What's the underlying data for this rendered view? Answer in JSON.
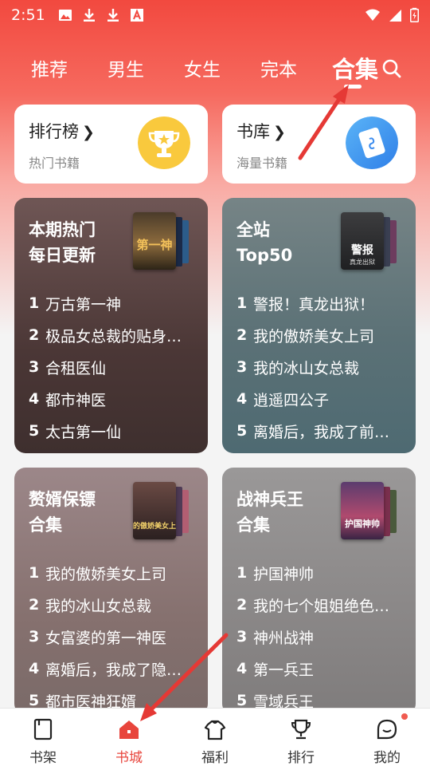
{
  "status_bar": {
    "time": "2:51",
    "left_icons": [
      "image-icon",
      "download-icon",
      "download-icon",
      "font-icon"
    ],
    "right_icons": [
      "wifi-icon",
      "signal-icon",
      "battery-icon"
    ]
  },
  "tabs": [
    {
      "label": "推荐",
      "active": false
    },
    {
      "label": "男生",
      "active": false
    },
    {
      "label": "女生",
      "active": false
    },
    {
      "label": "完本",
      "active": false
    },
    {
      "label": "合集",
      "active": true
    }
  ],
  "top_cards": [
    {
      "title": "排行榜",
      "chevron": "›",
      "subtitle": "热门书籍",
      "icon": "trophy-icon"
    },
    {
      "title": "书库",
      "chevron": "›",
      "subtitle": "海量书籍",
      "icon": "book-icon"
    }
  ],
  "collections": [
    {
      "title_line1": "本期热门",
      "title_line2": "每日更新",
      "cover_text": "第一神",
      "items": [
        {
          "num": "1",
          "name": "万古第一神"
        },
        {
          "num": "2",
          "name": "极品女总裁的贴身…"
        },
        {
          "num": "3",
          "name": "合租医仙"
        },
        {
          "num": "4",
          "name": "都市神医"
        },
        {
          "num": "5",
          "name": "太古第一仙"
        }
      ]
    },
    {
      "title_line1": "全站",
      "title_line2": "Top50",
      "cover_text": "警报",
      "cover_subtext": "真龙出狱",
      "items": [
        {
          "num": "1",
          "name": "警报！真龙出狱！"
        },
        {
          "num": "2",
          "name": "我的傲娇美女上司"
        },
        {
          "num": "3",
          "name": "我的冰山女总裁"
        },
        {
          "num": "4",
          "name": "逍遥四公子"
        },
        {
          "num": "5",
          "name": "离婚后，我成了前…"
        }
      ]
    },
    {
      "title_line1": "赘婿保镖",
      "title_line2": "合集",
      "cover_text": "我的傲娇美女上司",
      "items": [
        {
          "num": "1",
          "name": "我的傲娇美女上司"
        },
        {
          "num": "2",
          "name": "我的冰山女总裁"
        },
        {
          "num": "3",
          "name": "女富婆的第一神医"
        },
        {
          "num": "4",
          "name": "离婚后，我成了隐…"
        },
        {
          "num": "5",
          "name": "都市医神狂婿"
        }
      ]
    },
    {
      "title_line1": "战神兵王",
      "title_line2": "合集",
      "cover_text": "护国神帅",
      "items": [
        {
          "num": "1",
          "name": "护国神帅"
        },
        {
          "num": "2",
          "name": "我的七个姐姐绝色…"
        },
        {
          "num": "3",
          "name": "神州战神"
        },
        {
          "num": "4",
          "name": "第一兵王"
        },
        {
          "num": "5",
          "name": "雪域兵王"
        }
      ]
    }
  ],
  "bottom_nav": [
    {
      "label": "书架",
      "icon": "bookshelf-icon",
      "active": false
    },
    {
      "label": "书城",
      "icon": "home-icon",
      "active": true
    },
    {
      "label": "福利",
      "icon": "gift-shirt-icon",
      "active": false
    },
    {
      "label": "排行",
      "icon": "trophy-icon",
      "active": false
    },
    {
      "label": "我的",
      "icon": "profile-icon",
      "active": false,
      "badge": true
    }
  ],
  "colors": {
    "accent": "#e8453c",
    "header_red": "#f2493f",
    "annotation_arrow": "#e53935",
    "badge": "#f05b50",
    "card1_bg": "#4d3b3a",
    "card2_bg": "#5d7378",
    "card3_bg": "#8a7577",
    "card4_bg": "#8e8c8c"
  }
}
